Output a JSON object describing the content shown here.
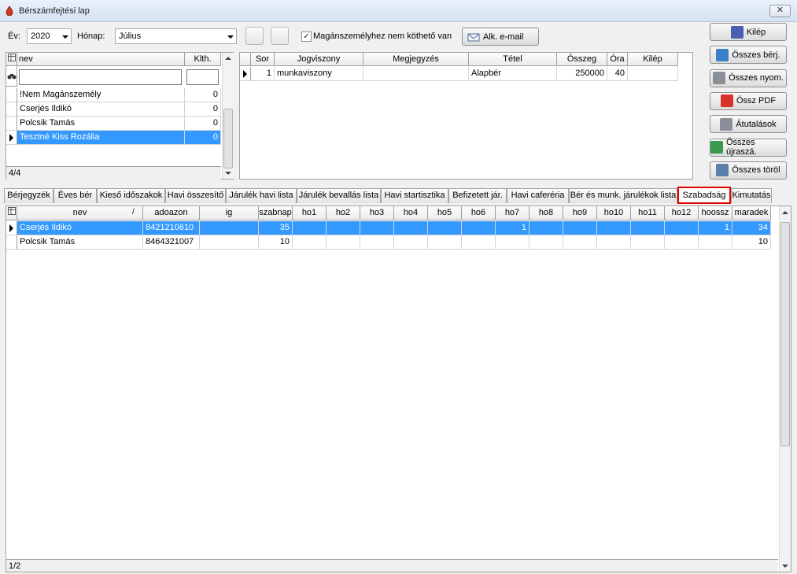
{
  "window": {
    "title": "Bérszámfejtési lap",
    "close_label": "✕"
  },
  "toolbar": {
    "ev_label": "Év:",
    "ev_value": "2020",
    "honap_label": "Hónap:",
    "honap_value": "Július",
    "checkbox_label": "Magánszemélyhez nem köthető van",
    "checkbox_checked": true,
    "email_button": "Alk. e-mail"
  },
  "right_buttons": [
    {
      "label": "Kilép",
      "icon": "door-exit-icon"
    },
    {
      "label": "Összes bérj.",
      "icon": "table-icon"
    },
    {
      "label": "Összes nyom.",
      "icon": "printer-icon"
    },
    {
      "label": "Össz PDF",
      "icon": "pdf-icon"
    },
    {
      "label": "Átutalások",
      "icon": "printer-icon"
    },
    {
      "label": "Összes újraszá.",
      "icon": "refresh-icon"
    },
    {
      "label": "Összes töröl",
      "icon": "delete-icon"
    }
  ],
  "employee_list": {
    "columns": [
      "nev",
      "Klth."
    ],
    "rows": [
      {
        "nev": "!Nem Magánszemély",
        "klth": "0"
      },
      {
        "nev": "Cserjés Ildikó",
        "klth": "0"
      },
      {
        "nev": "Polcsik Tamás",
        "klth": "0"
      },
      {
        "nev": "Tesztné Kiss Rozália",
        "klth": "0",
        "selected": true
      }
    ],
    "status": "4/4"
  },
  "detail_grid": {
    "columns": [
      "Sor",
      "Jogviszony",
      "Megjegyzés",
      "Tétel",
      "Összeg",
      "Óra",
      "Kilép"
    ],
    "rows": [
      {
        "sor": "1",
        "jogviszony": "munkaviszony",
        "megjegyzes": "",
        "tetel": "Alapbér",
        "osszeg": "250000",
        "ora": "40",
        "kilep": ""
      }
    ]
  },
  "tabs": [
    "Bérjegyzék",
    "Éves bér",
    "Kieső időszakok",
    "Havi összesítő",
    "Járulék havi lista",
    "Járulék bevallás lista",
    "Havi startisztika",
    "Befizetett jár.",
    "Havi caferéria",
    "Bér és munk. járulékok lista",
    "Szabadság",
    "Kimutatás"
  ],
  "active_tab": "Szabadság",
  "leave_grid": {
    "columns": [
      "nev",
      "adoazon",
      "ig",
      "szabnap",
      "ho1",
      "ho2",
      "ho3",
      "ho4",
      "ho5",
      "ho6",
      "ho7",
      "ho8",
      "ho9",
      "ho10",
      "ho11",
      "ho12",
      "hoossz",
      "maradek"
    ],
    "sort_indicator": "/",
    "rows": [
      {
        "cells": [
          "Cserjés Ildikó",
          "8421210610",
          "",
          "35",
          "",
          "",
          "",
          "",
          "",
          "",
          "1",
          "",
          "",
          "",
          "",
          "",
          "1",
          "34"
        ],
        "selected": true
      },
      {
        "cells": [
          "Polcsik Tamás",
          "8464321007",
          "",
          "10",
          "",
          "",
          "",
          "",
          "",
          "",
          "",
          "",
          "",
          "",
          "",
          "",
          "",
          "10"
        ]
      }
    ],
    "status": "1/2"
  }
}
